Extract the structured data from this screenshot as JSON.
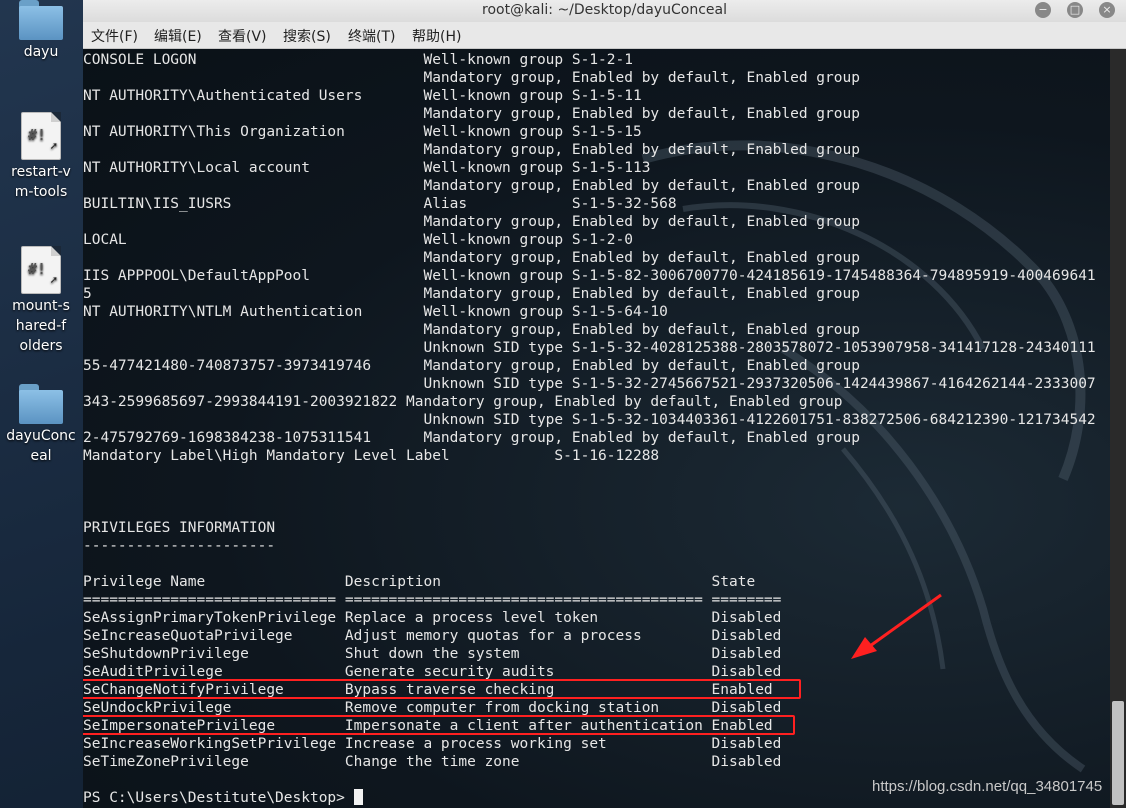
{
  "desktop": {
    "icons": [
      {
        "label": "dayu",
        "icon": "folder-icon"
      },
      {
        "label": "restart-vm-tools",
        "icon": "script-file-icon"
      },
      {
        "label": "mount-shared-folders",
        "icon": "script-file-icon"
      },
      {
        "label": "dayuConceal",
        "icon": "folder-icon"
      }
    ]
  },
  "window": {
    "title": "root@kali: ~/Desktop/dayuConceal",
    "controls": {
      "minimize": "−",
      "maximize": "□",
      "close": "×"
    },
    "menu": [
      "文件(F)",
      "编辑(E)",
      "查看(V)",
      "搜索(S)",
      "终端(T)",
      "帮助(H)"
    ]
  },
  "terminal": {
    "lines": [
      "CONSOLE LOGON                          Well-known group S-1-2-1",
      "                                       Mandatory group, Enabled by default, Enabled group",
      "NT AUTHORITY\\Authenticated Users       Well-known group S-1-5-11",
      "                                       Mandatory group, Enabled by default, Enabled group",
      "NT AUTHORITY\\This Organization         Well-known group S-1-5-15",
      "                                       Mandatory group, Enabled by default, Enabled group",
      "NT AUTHORITY\\Local account             Well-known group S-1-5-113",
      "                                       Mandatory group, Enabled by default, Enabled group",
      "BUILTIN\\IIS_IUSRS                      Alias            S-1-5-32-568",
      "                                       Mandatory group, Enabled by default, Enabled group",
      "LOCAL                                  Well-known group S-1-2-0",
      "                                       Mandatory group, Enabled by default, Enabled group",
      "IIS APPPOOL\\DefaultAppPool             Well-known group S-1-5-82-3006700770-424185619-1745488364-794895919-400469641",
      "5                                      Mandatory group, Enabled by default, Enabled group",
      "NT AUTHORITY\\NTLM Authentication       Well-known group S-1-5-64-10",
      "                                       Mandatory group, Enabled by default, Enabled group",
      "                                       Unknown SID type S-1-5-32-4028125388-2803578072-1053907958-341417128-24340111",
      "55-477421480-740873757-3973419746      Mandatory group, Enabled by default, Enabled group",
      "                                       Unknown SID type S-1-5-32-2745667521-2937320506-1424439867-4164262144-2333007",
      "343-2599685697-2993844191-2003921822 Mandatory group, Enabled by default, Enabled group",
      "                                       Unknown SID type S-1-5-32-1034403361-4122601751-838272506-684212390-121734542",
      "2-475792769-1698384238-1075311541      Mandatory group, Enabled by default, Enabled group",
      "Mandatory Label\\High Mandatory Level Label            S-1-16-12288",
      "",
      "",
      "",
      "PRIVILEGES INFORMATION",
      "----------------------",
      "",
      "Privilege Name                Description                               State",
      "============================= ========================================= ========",
      "SeAssignPrimaryTokenPrivilege Replace a process level token             Disabled",
      "SeIncreaseQuotaPrivilege      Adjust memory quotas for a process        Disabled",
      "SeShutdownPrivilege           Shut down the system                      Disabled",
      "SeAuditPrivilege              Generate security audits                  Disabled",
      "SeChangeNotifyPrivilege       Bypass traverse checking                  Enabled",
      "SeUndockPrivilege             Remove computer from docking station      Disabled",
      "SeImpersonatePrivilege        Impersonate a client after authentication Enabled",
      "SeIncreaseWorkingSetPrivilege Increase a process working set            Disabled",
      "SeTimeZonePrivilege           Change the time zone                      Disabled",
      "",
      "PS C:\\Users\\Destitute\\Desktop> "
    ]
  },
  "annotation": {
    "color": "#ff2020"
  },
  "watermark": "https://blog.csdn.net/qq_34801745"
}
